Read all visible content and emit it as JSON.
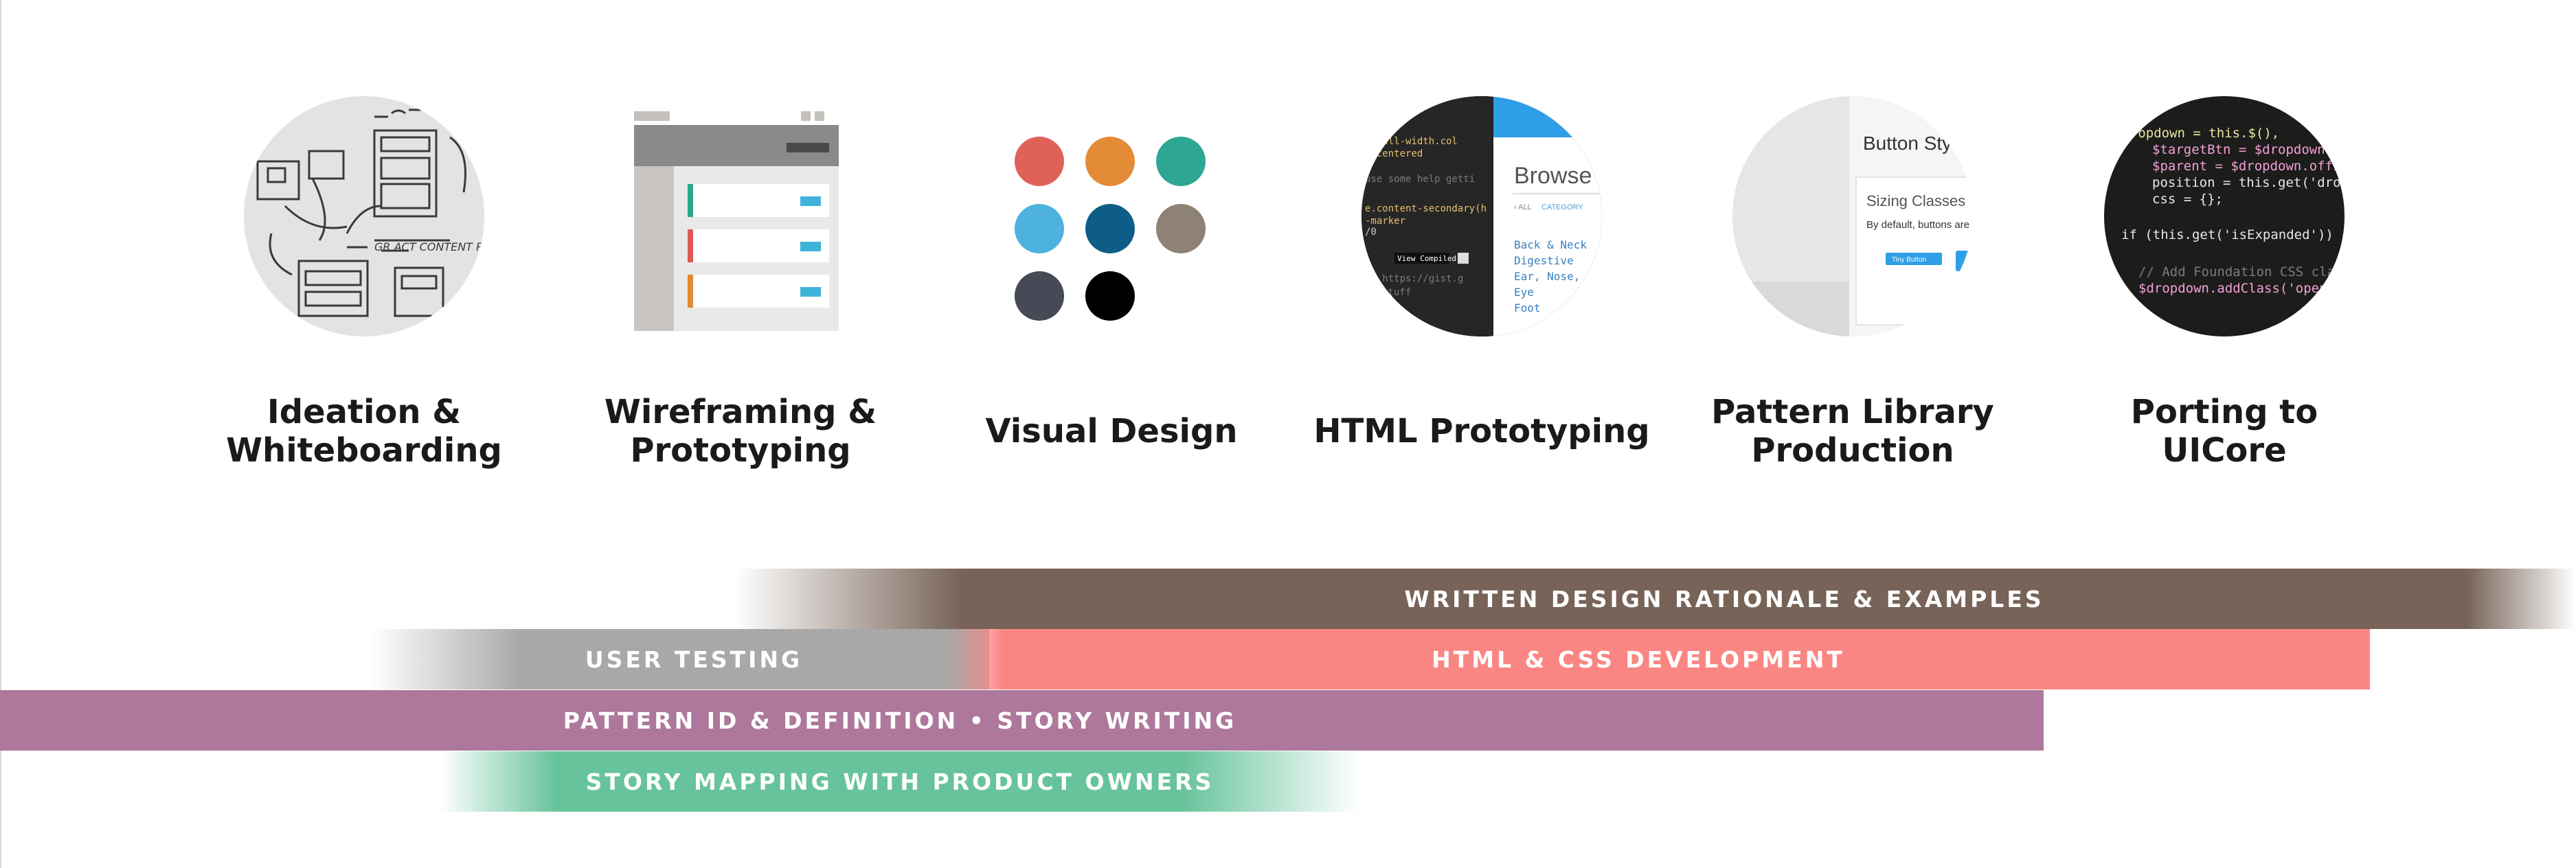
{
  "stages": [
    {
      "label": "Ideation &\nWhiteboarding",
      "icon": "whiteboard-sketch-icon"
    },
    {
      "label": "Wireframing &\nPrototyping",
      "icon": "wireframe-icon"
    },
    {
      "label": "Visual Design",
      "icon": "color-swatch-icon"
    },
    {
      "label": "HTML Prototyping",
      "icon": "html-prototype-screenshot-icon"
    },
    {
      "label": "Pattern Library\nProduction",
      "icon": "pattern-library-screenshot-icon"
    },
    {
      "label": "Porting to\nUICore",
      "icon": "code-screenshot-icon"
    }
  ],
  "bands": {
    "written_design": "WRITTEN DESIGN RATIONALE & EXAMPLES",
    "user_testing": "USER TESTING",
    "html_css": "HTML & CSS DEVELOPMENT",
    "pattern_id": "PATTERN ID & DEFINITION • STORY WRITING",
    "story_mapping": "STORY MAPPING WITH PRODUCT OWNERS"
  },
  "colors": {
    "brown": "#776357",
    "gray": "#a8a8a8",
    "salmon": "#fa8683",
    "purple": "#ad789b",
    "green": "#67c39c"
  },
  "swatches": [
    "#e0605a",
    "#e38b37",
    "#2da693",
    "#4db3de",
    "#0e5d88",
    "#8e8275",
    "#464a56",
    "#000000"
  ],
  "thumb_text": {
    "browse": "Browse",
    "all": "‹ ALL",
    "category": "CATEGORY",
    "links": [
      "Back & Neck",
      "Digestive",
      "Ear, Nose, and",
      "Eye",
      "Foot"
    ],
    "view_completed": "View Compiled",
    "css_lines": [
      "e.full-width.col",
      "l-centered",
      "use some help getti",
      "e.content-secondary(h",
      "-marker",
      "/0",
      "s: https://gist.g",
      "stuff"
    ],
    "button_style": "Button Style",
    "sizing_classes": "Sizing Classes",
    "by_default": "By default, buttons are",
    "tiny_button": "Tiny Button",
    "code_lines": [
      "$dropdown = this.$(),",
      "$targetBtn = $dropdown.p",
      "$parent = $dropdown.offse",
      "position = this.get('drop",
      "css = {};",
      "if (this.get('isExpanded')) {",
      "// Add Foundation CSS cla",
      "$dropdown.addClass('open"
    ]
  }
}
